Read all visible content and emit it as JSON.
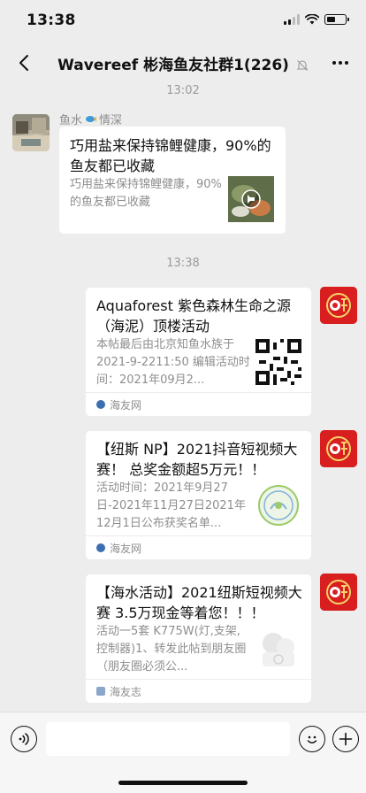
{
  "status_bar": {
    "time": "13:38",
    "battery_level": 0.45
  },
  "header": {
    "title": "Wavereef 彬海鱼友社群1(226)"
  },
  "timestamps": [
    "13:02",
    "13:38"
  ],
  "messages": [
    {
      "sender": "鱼水",
      "sender_suffix": "情深",
      "title": "巧用盐来保持锦鲤健康，90%的鱼友都已收藏",
      "desc": "巧用盐来保持锦鲤健康，90%的鱼友都已收藏"
    },
    {
      "title": "Aquaforest 紫色森林生命之源（海泥）顶楼活动",
      "desc": "本帖最后由北京知鱼水族于2021-9-2211:50 编辑活动时间：2021年09月2...",
      "source": "海友网"
    },
    {
      "title": "【纽斯 NP】2021抖音短视频大赛！ 总奖金额超5万元！！",
      "desc": "活动时间：2021年9月27日-2021年11月27日2021年12月1日公布获奖名单...",
      "source": "海友网"
    },
    {
      "title": "【海水活动】2021纽斯短视频大赛 3.5万现金等着您！！！",
      "desc": "活动一5套 K775W(灯,支架,控制器)1、转发此帖到朋友圈（朋友圈必须公...",
      "source": "海友志"
    }
  ],
  "colors": {
    "background": "#ededed",
    "card": "#ffffff",
    "brand_red": "#d81e1e"
  }
}
